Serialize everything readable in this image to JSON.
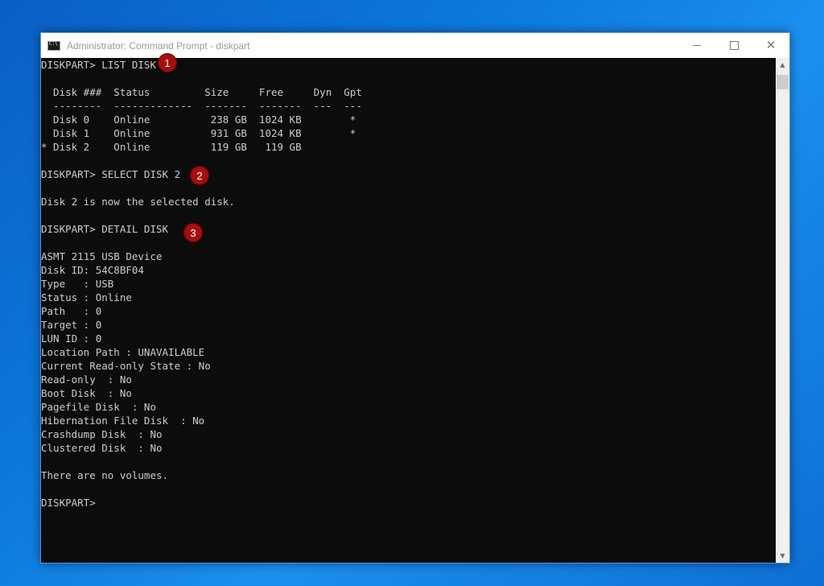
{
  "window": {
    "title": "Administrator: Command Prompt - diskpart"
  },
  "console": {
    "lines": [
      "DISKPART> LIST DISK",
      "",
      "  Disk ###  Status         Size     Free     Dyn  Gpt",
      "  --------  -------------  -------  -------  ---  ---",
      "  Disk 0    Online          238 GB  1024 KB        *",
      "  Disk 1    Online          931 GB  1024 KB        *",
      "* Disk 2    Online          119 GB   119 GB",
      "",
      "DISKPART> SELECT DISK 2",
      "",
      "Disk 2 is now the selected disk.",
      "",
      "DISKPART> DETAIL DISK",
      "",
      "ASMT 2115 USB Device",
      "Disk ID: 54C8BF04",
      "Type   : USB",
      "Status : Online",
      "Path   : 0",
      "Target : 0",
      "LUN ID : 0",
      "Location Path : UNAVAILABLE",
      "Current Read-only State : No",
      "Read-only  : No",
      "Boot Disk  : No",
      "Pagefile Disk  : No",
      "Hibernation File Disk  : No",
      "Crashdump Disk  : No",
      "Clustered Disk  : No",
      "",
      "There are no volumes.",
      "",
      "DISKPART> "
    ]
  },
  "annotations": {
    "step1": "1",
    "step2": "2",
    "step3": "3"
  },
  "icons": {
    "app": "command-prompt-icon",
    "minimize": "minimize-icon",
    "maximize": "maximize-icon",
    "close": "close-icon",
    "scroll_up": "scroll-up-arrow-icon",
    "scroll_down": "scroll-down-arrow-icon"
  },
  "colors": {
    "console_bg": "#0c0c0c",
    "console_text": "#cccccc",
    "badge": "#a50e0e"
  }
}
